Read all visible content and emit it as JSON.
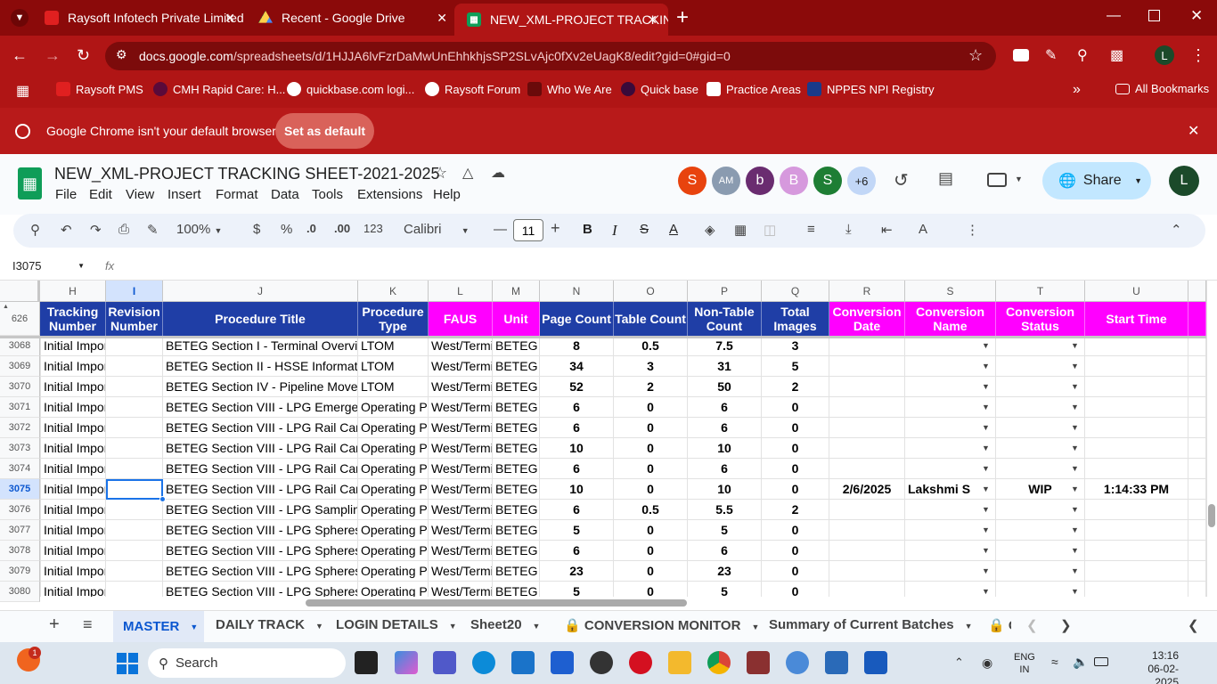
{
  "browser": {
    "tabs": [
      {
        "label": "Raysoft Infotech Private Limited"
      },
      {
        "label": "Recent - Google Drive"
      },
      {
        "label": "NEW_XML-PROJECT TRACKING"
      }
    ],
    "url_domain": "docs.google.com",
    "url_path": "/spreadsheets/d/1HJJA6lvFzrDaMwUnEhhkhjsSP2SLvAjc0fXv2eUagK8/edit?gid=0#gid=0",
    "bookmarks": [
      "Raysoft PMS",
      "CMH Rapid Care: H...",
      "quickbase.com logi...",
      "Raysoft Forum",
      "Who We Are",
      "Quick base",
      "Practice Areas",
      "NPPES NPI Registry"
    ],
    "all_bookmarks": "All Bookmarks",
    "profile_initial": "L"
  },
  "infobar": {
    "message": "Google Chrome isn't your default browser",
    "button": "Set as default"
  },
  "doc": {
    "title": "NEW_XML-PROJECT TRACKING SHEET-2021-2025",
    "menus": [
      "File",
      "Edit",
      "View",
      "Insert",
      "Format",
      "Data",
      "Tools",
      "Extensions",
      "Help"
    ],
    "collaborators": [
      {
        "initial": "S",
        "color": "#e8430e"
      },
      {
        "initial": "AM",
        "color": "#8a9bb0"
      },
      {
        "initial": "b",
        "color": "#6a2c70"
      },
      {
        "initial": "B",
        "color": "#d699dd"
      },
      {
        "initial": "S",
        "color": "#1e7e34"
      },
      {
        "initial": "+6",
        "color": "#c2d7f7"
      }
    ],
    "share_label": "Share",
    "user_initial": "L"
  },
  "toolbar": {
    "zoom": "100%",
    "currency": "$",
    "percent": "%",
    "dec_less": ".0",
    "dec_more": ".00",
    "format123": "123",
    "font": "Calibri",
    "font_size": "11"
  },
  "formula_bar": {
    "cell_ref": "I3075",
    "fx": "fx",
    "value": ""
  },
  "grid": {
    "frozen_row_num": "626",
    "columns": [
      "H",
      "I",
      "J",
      "K",
      "L",
      "M",
      "N",
      "O",
      "P",
      "Q",
      "R",
      "S",
      "T",
      "U"
    ],
    "headers": [
      "Tracking Number",
      "Revision Number",
      "Procedure Title",
      "Procedure Type",
      "FAUS",
      "Unit",
      "Page Count",
      "Table Count",
      "Non-Table Count",
      "Total Images",
      "Conversion Date",
      "Conversion Name",
      "Conversion Status",
      "Start Time"
    ],
    "rows": [
      {
        "num": "3068",
        "h": "Initial Impor",
        "i": "",
        "j": "BETEG Section I - Terminal Overview",
        "k": "LTOM",
        "l": "West/Termi",
        "m": "BETEG",
        "n": "8",
        "o": "0.5",
        "p": "7.5",
        "q": "3",
        "r": "",
        "s": "",
        "t": "",
        "u": ""
      },
      {
        "num": "3069",
        "h": "Initial Impor",
        "i": "",
        "j": "BETEG Section II - HSSE Information",
        "k": "LTOM",
        "l": "West/Termi",
        "m": "BETEG",
        "n": "34",
        "o": "3",
        "p": "31",
        "q": "5",
        "r": "",
        "s": "",
        "t": "",
        "u": ""
      },
      {
        "num": "3070",
        "h": "Initial Impor",
        "i": "",
        "j": "BETEG Section IV - Pipeline Moveme",
        "k": "LTOM",
        "l": "West/Termi",
        "m": "BETEG",
        "n": "52",
        "o": "2",
        "p": "50",
        "q": "2",
        "r": "",
        "s": "",
        "t": "",
        "u": ""
      },
      {
        "num": "3071",
        "h": "Initial Impor",
        "i": "",
        "j": "BETEG Section VIII - LPG Emergency",
        "k": "Operating Pr",
        "l": "West/Termi",
        "m": "BETEG",
        "n": "6",
        "o": "0",
        "p": "6",
        "q": "0",
        "r": "",
        "s": "",
        "t": "",
        "u": ""
      },
      {
        "num": "3072",
        "h": "Initial Impor",
        "i": "",
        "j": "BETEG Section VIII - LPG Rail Car Loa",
        "k": "Operating Pr",
        "l": "West/Termi",
        "m": "BETEG",
        "n": "6",
        "o": "0",
        "p": "6",
        "q": "0",
        "r": "",
        "s": "",
        "t": "",
        "u": ""
      },
      {
        "num": "3073",
        "h": "Initial Impor",
        "i": "",
        "j": "BETEG Section VIII - LPG Rail Car Loa",
        "k": "Operating Pr",
        "l": "West/Termi",
        "m": "BETEG",
        "n": "10",
        "o": "0",
        "p": "10",
        "q": "0",
        "r": "",
        "s": "",
        "t": "",
        "u": ""
      },
      {
        "num": "3074",
        "h": "Initial Impor",
        "i": "",
        "j": "BETEG Section VIII - LPG Rail Car Unl",
        "k": "Operating Pr",
        "l": "West/Termi",
        "m": "BETEG",
        "n": "6",
        "o": "0",
        "p": "6",
        "q": "0",
        "r": "",
        "s": "",
        "t": "",
        "u": ""
      },
      {
        "num": "3075",
        "h": "Initial Impor",
        "i": "",
        "j": "BETEG Section VIII - LPG Rail Car Unl",
        "k": "Operating Pr",
        "l": "West/Termi",
        "m": "BETEG",
        "n": "10",
        "o": "0",
        "p": "10",
        "q": "0",
        "r": "2/6/2025",
        "s": "Lakshmi S",
        "t": "WIP",
        "u": "1:14:33 PM"
      },
      {
        "num": "3076",
        "h": "Initial Impor",
        "i": "",
        "j": "BETEG Section VIII - LPG Sampling Pr",
        "k": "Operating Pr",
        "l": "West/Termi",
        "m": "BETEG",
        "n": "6",
        "o": "0.5",
        "p": "5.5",
        "q": "2",
        "r": "",
        "s": "",
        "t": "",
        "u": ""
      },
      {
        "num": "3077",
        "h": "Initial Impor",
        "i": "",
        "j": "BETEG Section VIII - LPG Spheres Inc",
        "k": "Operating Pr",
        "l": "West/Termi",
        "m": "BETEG",
        "n": "5",
        "o": "0",
        "p": "5",
        "q": "0",
        "r": "",
        "s": "",
        "t": "",
        "u": ""
      },
      {
        "num": "3078",
        "h": "Initial Impor",
        "i": "",
        "j": "BETEG Section VIII - LPG Spheres No",
        "k": "Operating Pr",
        "l": "West/Termi",
        "m": "BETEG",
        "n": "6",
        "o": "0",
        "p": "6",
        "q": "0",
        "r": "",
        "s": "",
        "t": "",
        "u": ""
      },
      {
        "num": "3079",
        "h": "Initial Impor",
        "i": "",
        "j": "BETEG Section VIII - LPG Spheres No",
        "k": "Operating Pr",
        "l": "West/Termi",
        "m": "BETEG",
        "n": "23",
        "o": "0",
        "p": "23",
        "q": "0",
        "r": "",
        "s": "",
        "t": "",
        "u": ""
      },
      {
        "num": "3080",
        "h": "Initial Impor",
        "i": "",
        "j": "BETEG Section VIII - LPG Spheres Sta",
        "k": "Operating Pr",
        "l": "West/Termi",
        "m": "BETEG",
        "n": "5",
        "o": "0",
        "p": "5",
        "q": "0",
        "r": "",
        "s": "",
        "t": "",
        "u": ""
      }
    ]
  },
  "sheets": {
    "tabs": [
      "MASTER",
      "DAILY TRACK",
      "LOGIN DETAILS",
      "Sheet20",
      "CONVERSION MONITOR",
      "Summary of Current Batches"
    ],
    "partial": "C"
  },
  "taskbar": {
    "search": "Search",
    "lang1": "ENG",
    "lang2": "IN",
    "time": "13:16",
    "date": "06-02-2025",
    "badge": "1"
  },
  "colors": {
    "header_blue": "#1f3ea6",
    "header_pink": "#ff00ff",
    "titlebar": "#8b0a0a",
    "chrome": "#b01515"
  }
}
